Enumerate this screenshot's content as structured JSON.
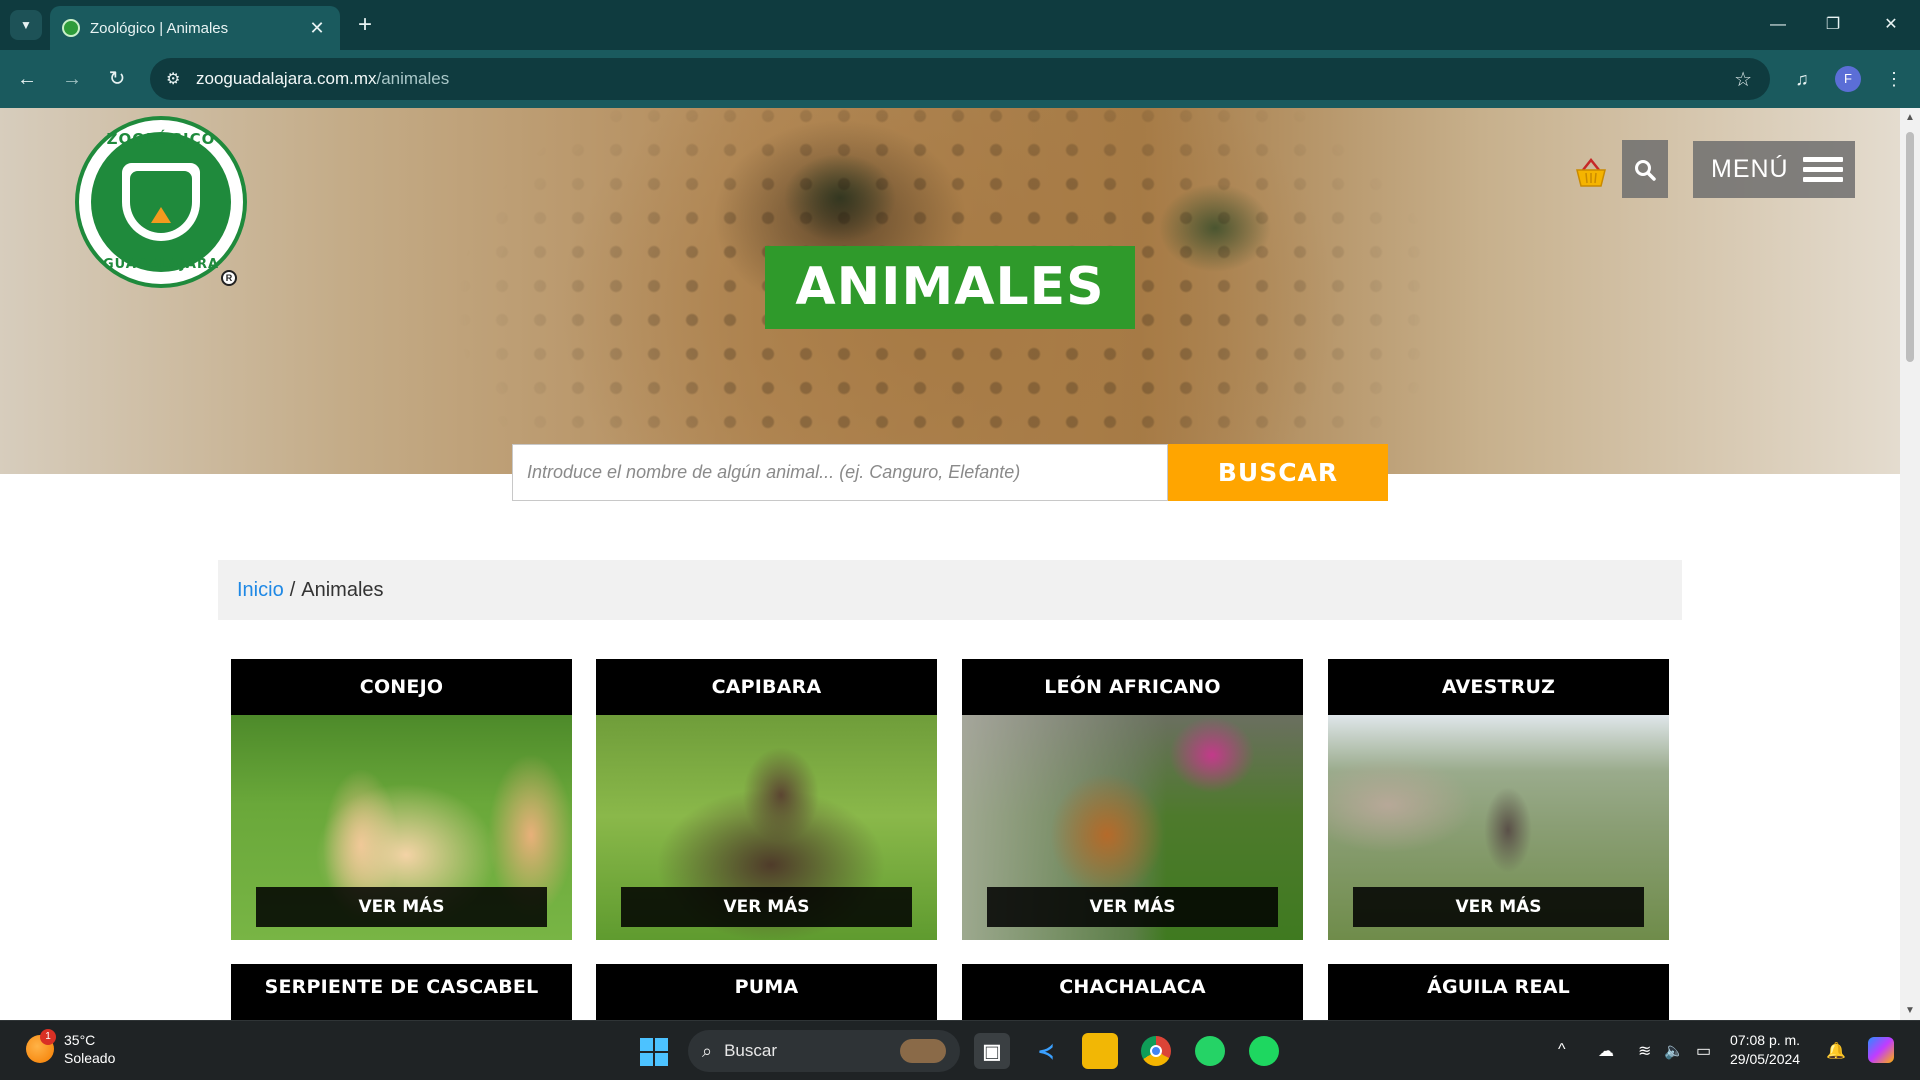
{
  "browser": {
    "tab_title": "Zoológico | Animales",
    "tab_close": "✕",
    "new_tab": "+",
    "url_host": "zooguadalajara.com.mx",
    "url_path": "/animales",
    "profile_initial": "F",
    "window_controls": {
      "minimize": "—",
      "restore": "❐",
      "close": "✕"
    }
  },
  "site": {
    "logo_top_text": "ZOOLÓGICO",
    "logo_bottom_text": "GUADALAJARA",
    "registered_mark": "R",
    "menu_label": "MENÚ",
    "hero_title": "ANIMALES",
    "search": {
      "placeholder": "Introduce el nombre de algún animal... (ej. Canguro, Elefante)",
      "button_label": "BUSCAR"
    },
    "breadcrumb": {
      "home": "Inicio",
      "separator": "/",
      "current": "Animales"
    },
    "ver_mas_label": "VER MÁS",
    "animals": [
      {
        "name": "CONEJO"
      },
      {
        "name": "CAPIBARA"
      },
      {
        "name": "LEÓN AFRICANO"
      },
      {
        "name": "AVESTRUZ"
      },
      {
        "name": "SERPIENTE DE CASCABEL"
      },
      {
        "name": "PUMA"
      },
      {
        "name": "CHACHALACA"
      },
      {
        "name": "ÁGUILA REAL"
      }
    ],
    "colors": {
      "green": "#2f9a2b",
      "orange": "#ffa500",
      "link": "#1e88e5"
    }
  },
  "taskbar": {
    "weather_temp": "35°C",
    "weather_desc": "Soleado",
    "weather_badge": "1",
    "search_label": "Buscar",
    "time": "07:08 p. m.",
    "date": "29/05/2024"
  }
}
